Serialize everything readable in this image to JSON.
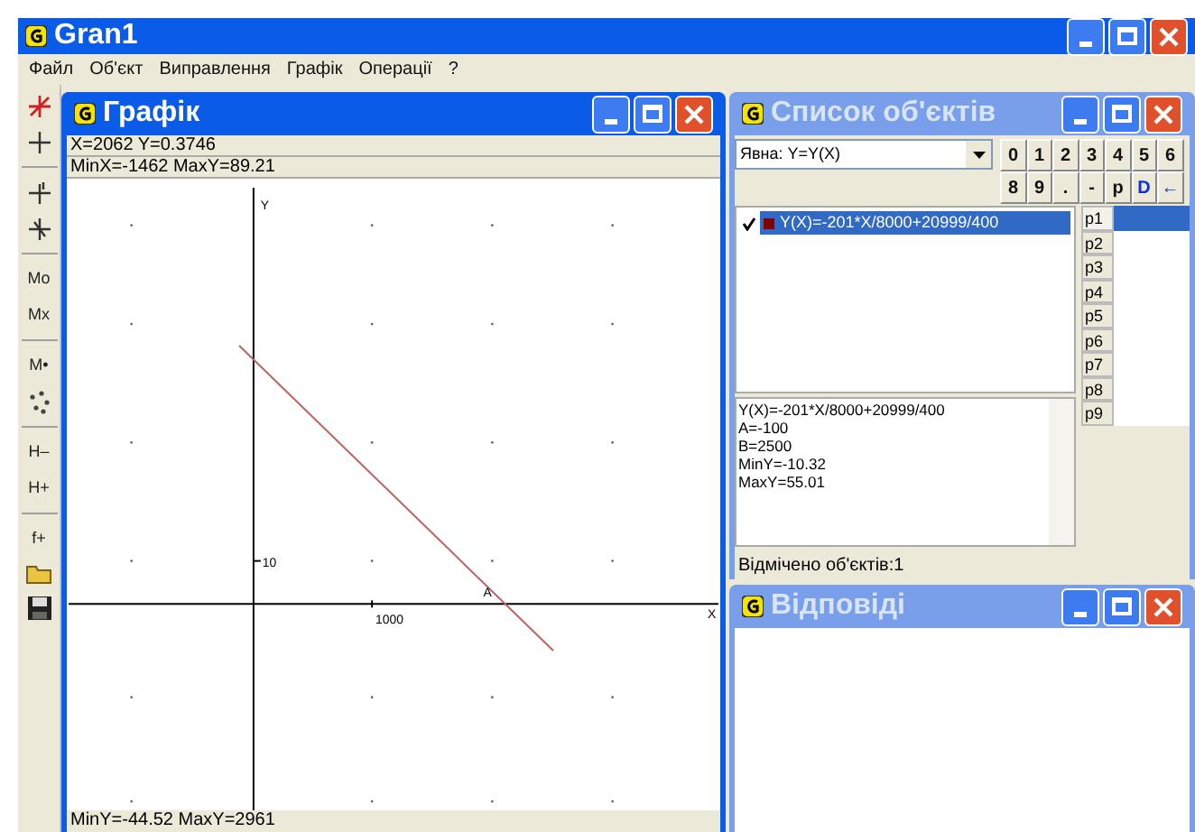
{
  "app_title": "Gran1",
  "menu": [
    "Файл",
    "Об'єкт",
    "Виправлення",
    "Графік",
    "Операції",
    "?"
  ],
  "toolbar": [
    {
      "kind": "pen"
    },
    {
      "kind": "plus"
    },
    {
      "kind": "sep"
    },
    {
      "kind": "cross1"
    },
    {
      "kind": "cross2"
    },
    {
      "kind": "sep"
    },
    {
      "kind": "text",
      "label": "Mo"
    },
    {
      "kind": "text",
      "label": "Mx"
    },
    {
      "kind": "sep"
    },
    {
      "kind": "text",
      "label": "M•"
    },
    {
      "kind": "dots"
    },
    {
      "kind": "sep"
    },
    {
      "kind": "text",
      "label": "H–"
    },
    {
      "kind": "text",
      "label": "H+"
    },
    {
      "kind": "sep"
    },
    {
      "kind": "text",
      "label": "f+"
    },
    {
      "kind": "folder"
    },
    {
      "kind": "save"
    }
  ],
  "graph_window": {
    "title": "Графік",
    "info": [
      "X=2062  Y=0.3746",
      "MinX=-1462  MaxY=89.21"
    ],
    "y_axis_label": "Y",
    "x_axis_label": "X",
    "y_tick": "10",
    "x_tick": "1000",
    "point_label": "A",
    "status": "MinY=-44.52  MaxY=2961"
  },
  "objects_window": {
    "title": "Список об'єктів",
    "type_select": "Явна: Y=Y(X)",
    "keys_row_1": [
      {
        "label": "0",
        "kind": "plain"
      },
      {
        "label": "1",
        "kind": "plain"
      },
      {
        "label": "2",
        "kind": "plain"
      },
      {
        "label": "3",
        "kind": "plain"
      },
      {
        "label": "4",
        "kind": "plain"
      },
      {
        "label": "5",
        "kind": "plain"
      },
      {
        "label": "6",
        "kind": "plain"
      }
    ],
    "keys_row_2": [
      {
        "label": "8",
        "kind": "plain"
      },
      {
        "label": "9",
        "kind": "plain"
      },
      {
        "label": ".",
        "kind": "plain"
      },
      {
        "label": "-",
        "kind": "plain"
      },
      {
        "label": "p",
        "kind": "plain"
      },
      {
        "label": "D",
        "kind": "blue"
      },
      {
        "label": "←",
        "kind": "blue"
      }
    ],
    "objects": [
      {
        "label": "Y(X)=-201*X/8000+20999/400",
        "checked": true,
        "selected": true,
        "color": "#800000"
      }
    ],
    "params": [
      {
        "label": "p1",
        "selected": true
      },
      {
        "label": "p2",
        "selected": false
      },
      {
        "label": "p3",
        "selected": false
      },
      {
        "label": "p4",
        "selected": false
      },
      {
        "label": "p5",
        "selected": false
      },
      {
        "label": "p6",
        "selected": false
      },
      {
        "label": "p7",
        "selected": false
      },
      {
        "label": "p8",
        "selected": false
      },
      {
        "label": "p9",
        "selected": false
      }
    ],
    "details": [
      "Y(X)=-201*X/8000+20999/400",
      "A=-100",
      "B=2500",
      "MinY=-10.32",
      "MaxY=55.01"
    ],
    "status": "Відмічено об'єктів:1"
  },
  "answers_window": {
    "title": "Відповіді"
  }
}
